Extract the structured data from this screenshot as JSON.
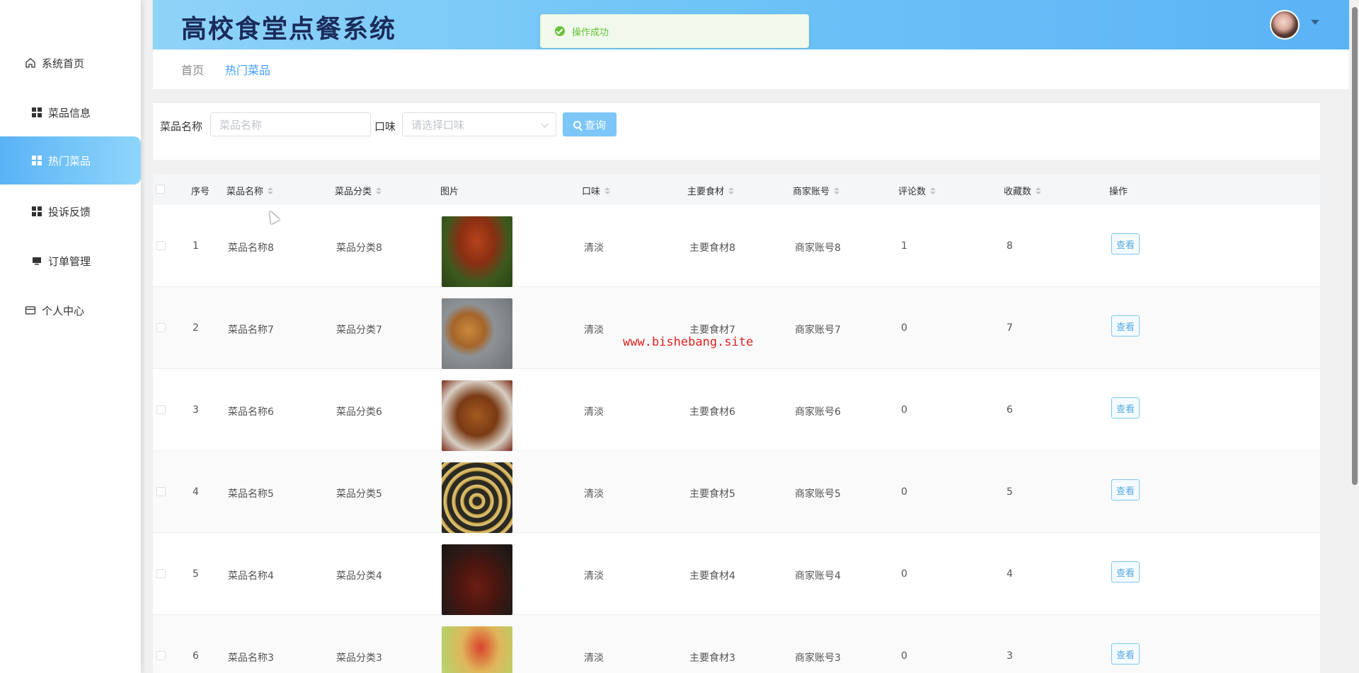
{
  "app": {
    "title": "高校食堂点餐系统"
  },
  "sidebar": {
    "items": [
      {
        "label": "系统首页",
        "icon": "home-icon",
        "active": false
      },
      {
        "label": "菜品信息",
        "icon": "grid-icon",
        "active": false
      },
      {
        "label": "热门菜品",
        "icon": "grid-icon",
        "active": true
      },
      {
        "label": "投诉反馈",
        "icon": "grid-icon",
        "active": false
      },
      {
        "label": "订单管理",
        "icon": "monitor-icon",
        "active": false
      },
      {
        "label": "个人中心",
        "icon": "card-icon",
        "active": false
      }
    ]
  },
  "toast": {
    "text": "操作成功"
  },
  "breadcrumb": {
    "home": "首页",
    "current": "热门菜品"
  },
  "search": {
    "name_label": "菜品名称",
    "name_placeholder": "菜品名称",
    "taste_label": "口味",
    "taste_placeholder": "请选择口味",
    "button_label": "查询"
  },
  "table": {
    "headers": {
      "index": "序号",
      "name": "菜品名称",
      "category": "菜品分类",
      "image": "图片",
      "taste": "口味",
      "ingredient": "主要食材",
      "merchant": "商家账号",
      "comments": "评论数",
      "favorites": "收藏数",
      "actions": "操作"
    },
    "rows": [
      {
        "index": "1",
        "name": "菜品名称8",
        "category": "菜品分类8",
        "taste": "清淡",
        "ingredient": "主要食材8",
        "merchant": "商家账号8",
        "comments": "1",
        "favorites": "8",
        "view": "查看"
      },
      {
        "index": "2",
        "name": "菜品名称7",
        "category": "菜品分类7",
        "taste": "清淡",
        "ingredient": "主要食材7",
        "merchant": "商家账号7",
        "comments": "0",
        "favorites": "7",
        "view": "查看"
      },
      {
        "index": "3",
        "name": "菜品名称6",
        "category": "菜品分类6",
        "taste": "清淡",
        "ingredient": "主要食材6",
        "merchant": "商家账号6",
        "comments": "0",
        "favorites": "6",
        "view": "查看"
      },
      {
        "index": "4",
        "name": "菜品名称5",
        "category": "菜品分类5",
        "taste": "清淡",
        "ingredient": "主要食材5",
        "merchant": "商家账号5",
        "comments": "0",
        "favorites": "5",
        "view": "查看"
      },
      {
        "index": "5",
        "name": "菜品名称4",
        "category": "菜品分类4",
        "taste": "清淡",
        "ingredient": "主要食材4",
        "merchant": "商家账号4",
        "comments": "0",
        "favorites": "4",
        "view": "查看"
      },
      {
        "index": "6",
        "name": "菜品名称3",
        "category": "菜品分类3",
        "taste": "清淡",
        "ingredient": "主要食材3",
        "merchant": "商家账号3",
        "comments": "0",
        "favorites": "3",
        "view": "查看"
      }
    ]
  },
  "watermark": "www.bishebang.site",
  "colors": {
    "accent": "#409eff",
    "success": "#67c23a",
    "header_start": "#8fd3f8",
    "header_end": "#5bb3f5"
  }
}
